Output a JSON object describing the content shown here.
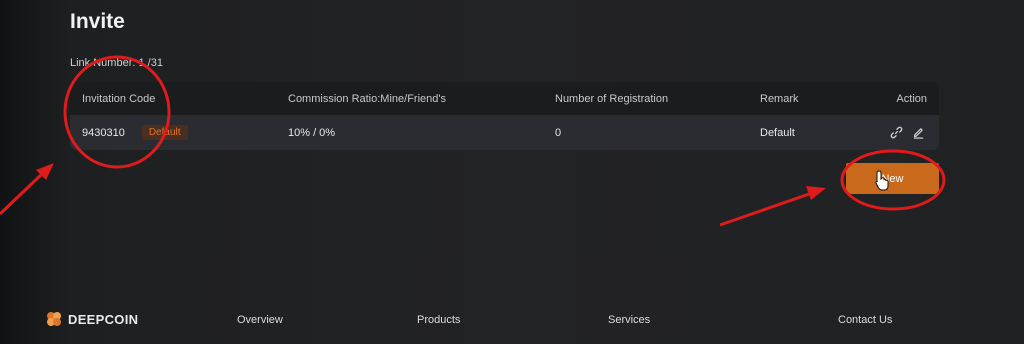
{
  "page": {
    "title": "Invite",
    "link_number": "Link Number: 1 /31"
  },
  "table": {
    "columns": [
      "Invitation Code",
      "Commission Ratio:Mine/Friend's",
      "Number of Registration",
      "Remark",
      "Action"
    ],
    "rows": [
      {
        "code": "9430310",
        "badge": "Default",
        "ratio": "10% / 0%",
        "registrations": "0",
        "remark": "Default"
      }
    ],
    "action_icons": [
      "link-icon",
      "edit-icon"
    ]
  },
  "new_button": {
    "label": "New"
  },
  "footer": {
    "brand": "DEEPCOIN",
    "links": [
      "Overview",
      "Products",
      "Services",
      "Contact Us"
    ]
  },
  "colors": {
    "accent": "#c8691c",
    "badge_text": "#e0722d",
    "annotation_red": "#e01b1b",
    "background": "#1f2022"
  }
}
